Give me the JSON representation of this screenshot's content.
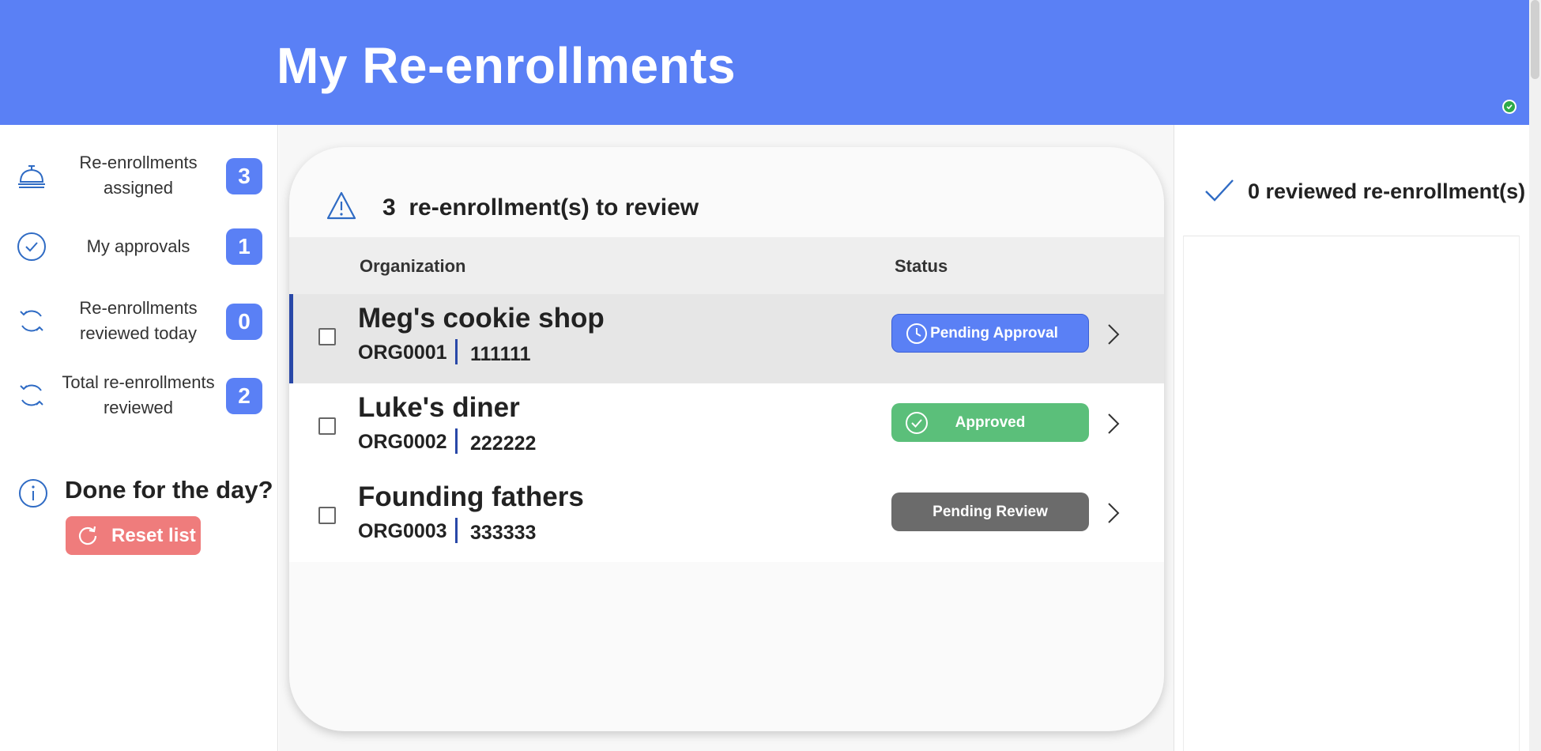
{
  "header": {
    "title": "My Re-enrollments"
  },
  "sidebar": {
    "stats": [
      {
        "label_line1": "Re-enrollments",
        "label_line2": "assigned",
        "count": "3",
        "icon": "service-bell-icon"
      },
      {
        "label_line1": "My approvals",
        "label_line2": "",
        "count": "1",
        "icon": "check-circle-icon"
      },
      {
        "label_line1": "Re-enrollments",
        "label_line2": "reviewed today",
        "count": "0",
        "icon": "refresh-icon"
      },
      {
        "label_line1": "Total re-enrollments",
        "label_line2": "reviewed",
        "count": "2",
        "icon": "refresh-icon"
      }
    ],
    "done_title": "Done for the day?",
    "reset_label": "Reset list"
  },
  "review": {
    "count": "3",
    "title_suffix": "re-enrollment(s) to review",
    "columns": {
      "organization": "Organization",
      "status": "Status"
    },
    "rows": [
      {
        "name": "Meg's cookie shop",
        "org_id": "ORG0001",
        "code": "111111",
        "status": "Pending Approval",
        "status_icon": "clock-icon",
        "selected": true
      },
      {
        "name": "Luke's diner",
        "org_id": "ORG0002",
        "code": "222222",
        "status": "Approved",
        "status_icon": "check-circle-icon",
        "selected": false
      },
      {
        "name": "Founding fathers",
        "org_id": "ORG0003",
        "code": "333333",
        "status": "Pending Review",
        "status_icon": "",
        "selected": false
      }
    ]
  },
  "reviewed": {
    "title": "0 reviewed re-enrollment(s)"
  },
  "colors": {
    "header": "#5a80f5",
    "pending_approval": "#5a80f5",
    "approved": "#5bbf7a",
    "pending_review": "#6b6b6b",
    "reset": "#ef7c7c",
    "accent_dark": "#2948a8"
  }
}
